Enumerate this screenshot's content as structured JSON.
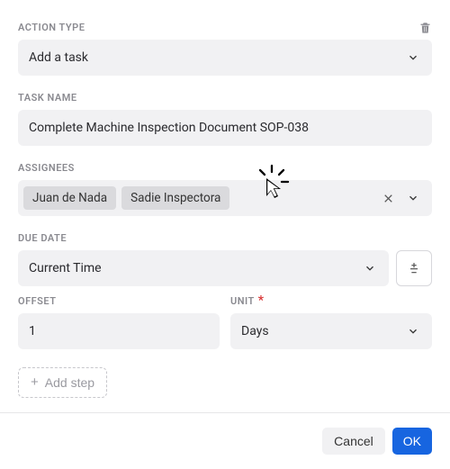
{
  "labels": {
    "action_type": "ACTION TYPE",
    "task_name": "TASK NAME",
    "assignees": "ASSIGNEES",
    "due_date": "DUE DATE",
    "offset": "OFFSET",
    "unit": "UNIT"
  },
  "actionType": {
    "value": "Add a task"
  },
  "taskName": {
    "value": "Complete Machine Inspection Document SOP-038"
  },
  "assignees": {
    "chips": [
      "Juan de Nada",
      "Sadie Inspectora"
    ]
  },
  "dueDate": {
    "value": "Current Time"
  },
  "offset": {
    "value": "1"
  },
  "unit": {
    "value": "Days",
    "required": true
  },
  "buttons": {
    "addStep": "Add step",
    "cancel": "Cancel",
    "ok": "OK",
    "offsetToggle": "±"
  },
  "icons": {
    "trash": "trash-icon",
    "chevronDown": "chevron-down-icon",
    "clear": "close-icon",
    "plus": "+"
  }
}
